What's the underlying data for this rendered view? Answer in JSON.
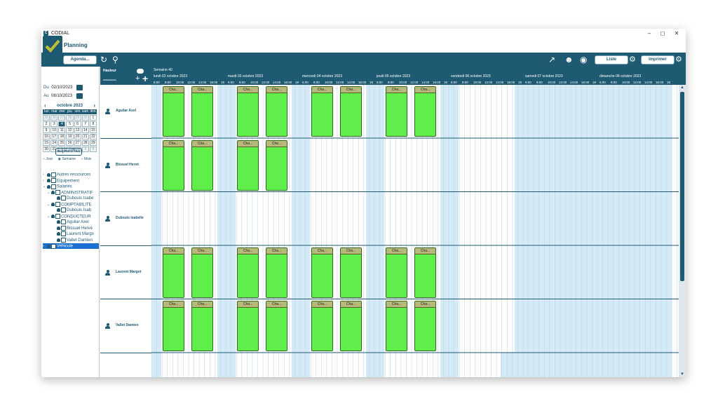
{
  "window": {
    "title": "CODIAL",
    "app_icon": "C"
  },
  "page": {
    "title": "Planning"
  },
  "toolbar": {
    "agenda_label": "Agenda...",
    "liste_label": "Liste",
    "imprimer_label": "Imprimer"
  },
  "sidebar": {
    "du_label": "Du",
    "du_value": "02/10/2023",
    "au_label": "Au",
    "au_value": "08/10/2023",
    "month_title": "octobre 2023",
    "weekdays": [
      "lun",
      "mar",
      "mer",
      "jeu",
      "ven",
      "sam",
      "dim"
    ],
    "days": [
      "25",
      "26",
      "27",
      "28",
      "29",
      "30",
      "1",
      "2",
      "3",
      "4",
      "5",
      "6",
      "7",
      "8",
      "9",
      "10",
      "11",
      "12",
      "13",
      "14",
      "15",
      "16",
      "17",
      "18",
      "19",
      "20",
      "21",
      "22",
      "23",
      "24",
      "25",
      "26",
      "27",
      "28",
      "29",
      "30",
      "31",
      "1",
      "2",
      "3",
      "4",
      "5"
    ],
    "today_label": "aujourd'hui",
    "view_jour": "Jour",
    "view_semaine": "Semaine",
    "view_mois": "Mois",
    "tree": [
      {
        "label": "Autres ressources"
      },
      {
        "label": "Equipement"
      },
      {
        "label": "Salariés"
      },
      {
        "label": "ADMINISTRATIF"
      },
      {
        "label": "Dubouis Isabe"
      },
      {
        "label": "COMPTABILITE"
      },
      {
        "label": "Dubouis Isab"
      },
      {
        "label": "CONDUCTEUR"
      },
      {
        "label": "Aguilar Axel"
      },
      {
        "label": "Bissuel Hervé"
      },
      {
        "label": "Laurent Margo"
      },
      {
        "label": "Vallet Damien"
      },
      {
        "label": "Véhicule"
      }
    ]
  },
  "planning": {
    "hauteur_label": "Hauteur",
    "semaine_label": "Semaine 40",
    "days": [
      "lundi 02 octobre 2023",
      "mardi 03 octobre 2023",
      "mercredi 04 octobre 2023",
      "jeudi 05 octobre 2023",
      "vendredi 06 octobre 2023",
      "samedi 07 octobre 2023",
      "dimanche 08 octobre 2023"
    ],
    "hours": [
      "6:00",
      "8:00",
      "10:00",
      "12:00",
      "14:00",
      "16:00",
      "18"
    ],
    "rows": [
      {
        "name": "Aguilar Axel",
        "events": [
          "Cha...",
          "Cha...",
          "Cha...",
          "Cha...",
          "Cha...",
          "Cha...",
          "Cha...",
          "Cha..."
        ]
      },
      {
        "name": "Bissuel Hervé",
        "events": [
          "Cha...",
          "Cha...",
          "Cha...",
          "Che..."
        ]
      },
      {
        "name": "Dubouis Isabelle",
        "events": []
      },
      {
        "name": "Laurent Margot",
        "events": [
          "Cha...",
          "Cha...",
          "Cha...",
          "Cha...",
          "Cha...",
          "Cha...",
          "Cha...",
          "Cha..."
        ]
      },
      {
        "name": "Vallet Damien",
        "events": [
          "Cha...",
          "Cha...",
          "Cha...",
          "Cha...",
          "Cha...",
          "Cha...",
          "Cha...",
          "Cha..."
        ]
      }
    ]
  },
  "colors": {
    "primary": "#1f5a73",
    "event_fill": "#60ee4a",
    "event_header": "#b7b87a",
    "offhours": "#d4eaf7"
  }
}
